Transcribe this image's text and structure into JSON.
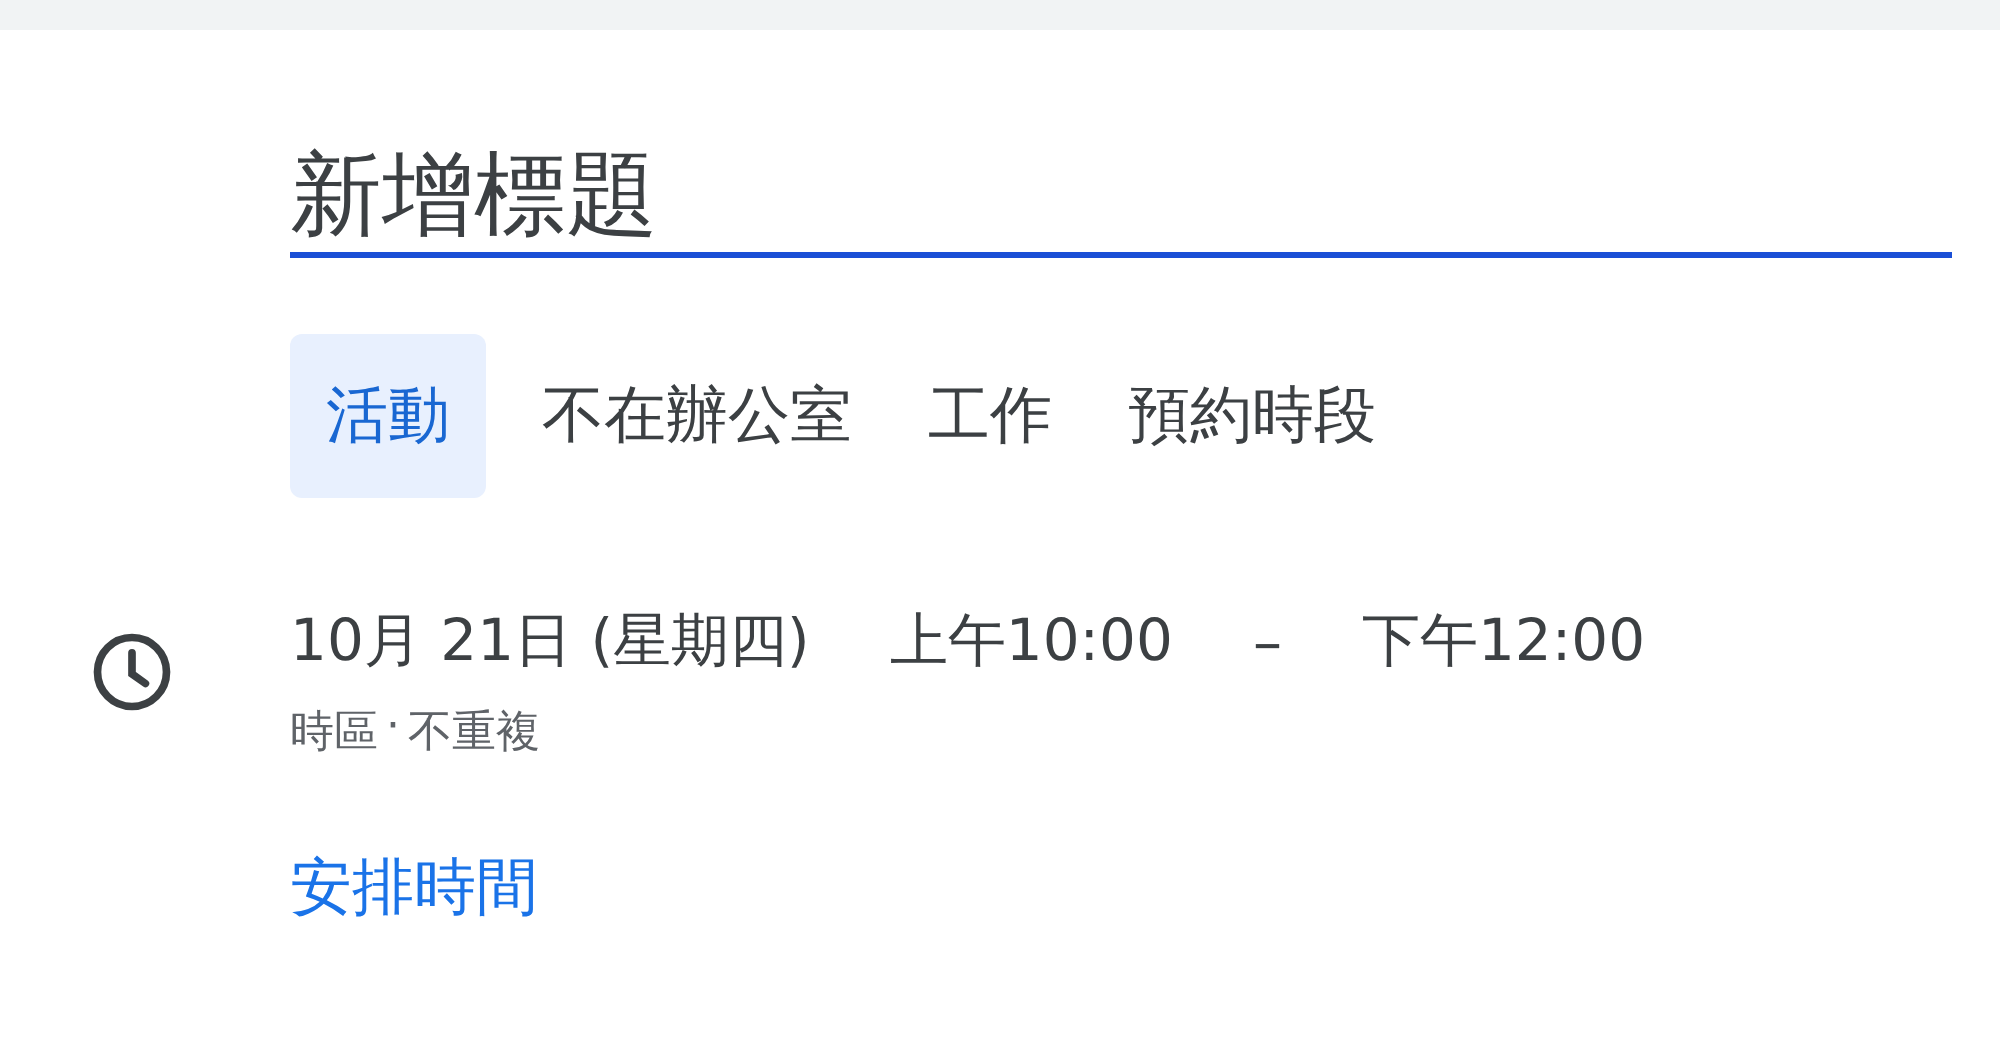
{
  "title_field": {
    "placeholder": "新增標題"
  },
  "tabs": [
    {
      "label": "活動",
      "selected": true
    },
    {
      "label": "不在辦公室",
      "selected": false
    },
    {
      "label": "工作",
      "selected": false
    },
    {
      "label": "預約時段",
      "selected": false
    }
  ],
  "when": {
    "date": "10月 21日 (星期四)",
    "start": "上午10:00",
    "dash": "–",
    "end": "下午12:00",
    "timezone": "時區",
    "separator": "·",
    "recurrence": "不重複"
  },
  "schedule_link": "安排時間"
}
